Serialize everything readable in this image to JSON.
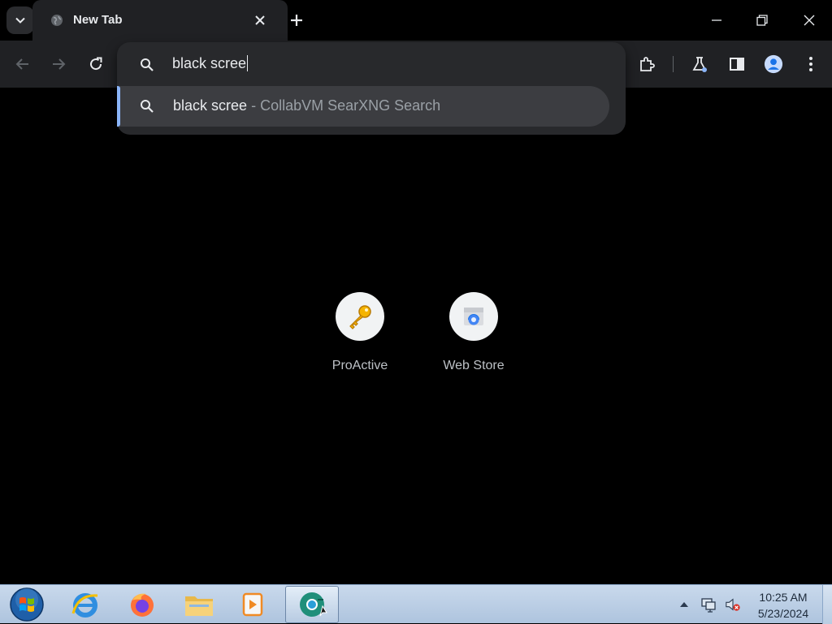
{
  "browser": {
    "tab": {
      "title": "New Tab",
      "favicon": "globe-icon"
    },
    "toolbar_icons": [
      "back-arrow-icon",
      "forward-arrow-icon",
      "reload-icon",
      "extensions-icon",
      "labs-flask-icon",
      "side-panel-icon",
      "profile-icon",
      "menu-dots-icon"
    ]
  },
  "omnibox": {
    "query": "black scree",
    "suggestion": {
      "query": "black scree",
      "separator": "-",
      "engine": "CollabVM SearXNG Search"
    }
  },
  "shortcuts": [
    {
      "label": "ProActive",
      "icon": "key-icon"
    },
    {
      "label": "Web Store",
      "icon": "web-store-icon"
    }
  ],
  "taskbar": {
    "apps": [
      "internet-explorer-icon",
      "firefox-icon",
      "file-explorer-icon",
      "media-player-icon",
      "chrome-icon"
    ],
    "clock": {
      "time": "10:25 AM",
      "date": "5/23/2024"
    }
  },
  "colors": {
    "accent": "#8ab4f8",
    "toolbar": "#202124",
    "omnibox": "#28292c",
    "taskbar": "#aec4de"
  }
}
